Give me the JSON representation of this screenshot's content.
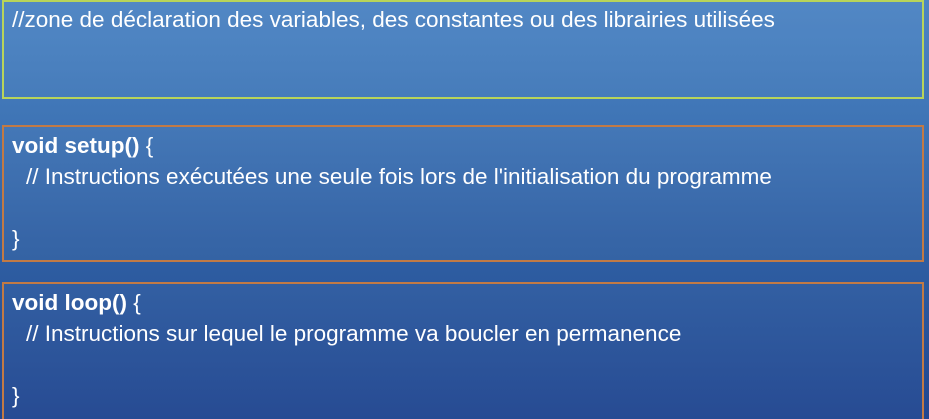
{
  "declaration": {
    "comment": "//zone de déclaration des variables, des constantes ou des librairies utilisées"
  },
  "setup": {
    "signature": "void setup()",
    "open_brace": " {",
    "comment": "// Instructions exécutées une seule fois lors de l'initialisation du programme",
    "close_brace": "}"
  },
  "loop": {
    "signature": "void loop()",
    "open_brace": " {",
    "comment": "// Instructions sur lequel le programme va boucler en permanence",
    "close_brace": "}"
  },
  "colors": {
    "declaration_border": "#b8d45a",
    "function_border": "#c27a45",
    "background_top": "#4d85c4",
    "background_bottom": "#214690"
  }
}
